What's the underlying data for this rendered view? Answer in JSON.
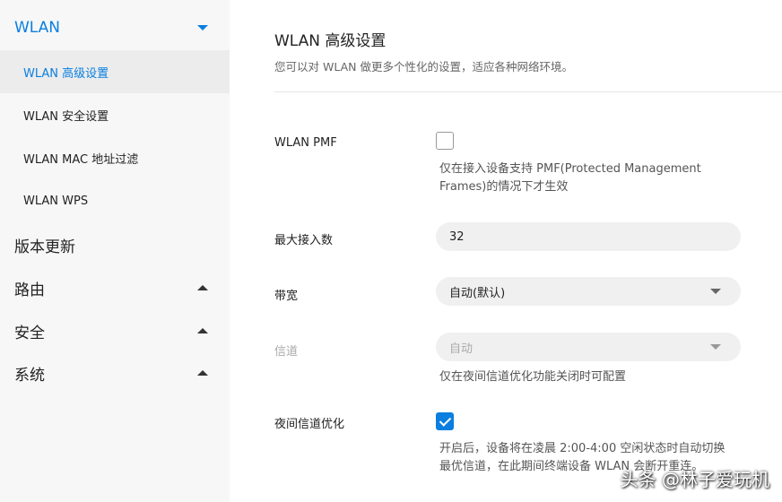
{
  "sidebar": {
    "wlan": {
      "label": "WLAN"
    },
    "wlan_items": [
      {
        "label": "WLAN 高级设置"
      },
      {
        "label": "WLAN 安全设置"
      },
      {
        "label": "WLAN MAC 地址过滤"
      },
      {
        "label": "WLAN WPS"
      }
    ],
    "version_update": {
      "label": "版本更新"
    },
    "routing": {
      "label": "路由"
    },
    "security": {
      "label": "安全"
    },
    "system": {
      "label": "系统"
    }
  },
  "main": {
    "title": "WLAN 高级设置",
    "description": "您可以对 WLAN 做更多个性化的设置，适应各种网络环境。",
    "pmf": {
      "label": "WLAN PMF",
      "checked": false,
      "hint_line1": "仅在接入设备支持 PMF(Protected Management",
      "hint_line2": "Frames)的情况下才生效"
    },
    "max_clients": {
      "label": "最大接入数",
      "value": "32"
    },
    "bandwidth": {
      "label": "带宽",
      "value": "自动(默认)"
    },
    "channel": {
      "label": "信道",
      "value": "自动",
      "hint": "仅在夜间信道优化功能关闭时可配置"
    },
    "night_opt": {
      "label": "夜间信道优化",
      "checked": true,
      "hint_line1": "开启后，设备将在凌晨 2:00-4:00 空闲状态时自动切换",
      "hint_line2": "最优信道，在此期间终端设备 WLAN 会断开重连。"
    }
  },
  "watermark": "头条 @林子爱玩机",
  "colors": {
    "accent": "#0a7fe0",
    "sidebar_bg": "#f7f7f7",
    "selected_bg": "#ececec",
    "field_bg": "#f0f0f0"
  }
}
